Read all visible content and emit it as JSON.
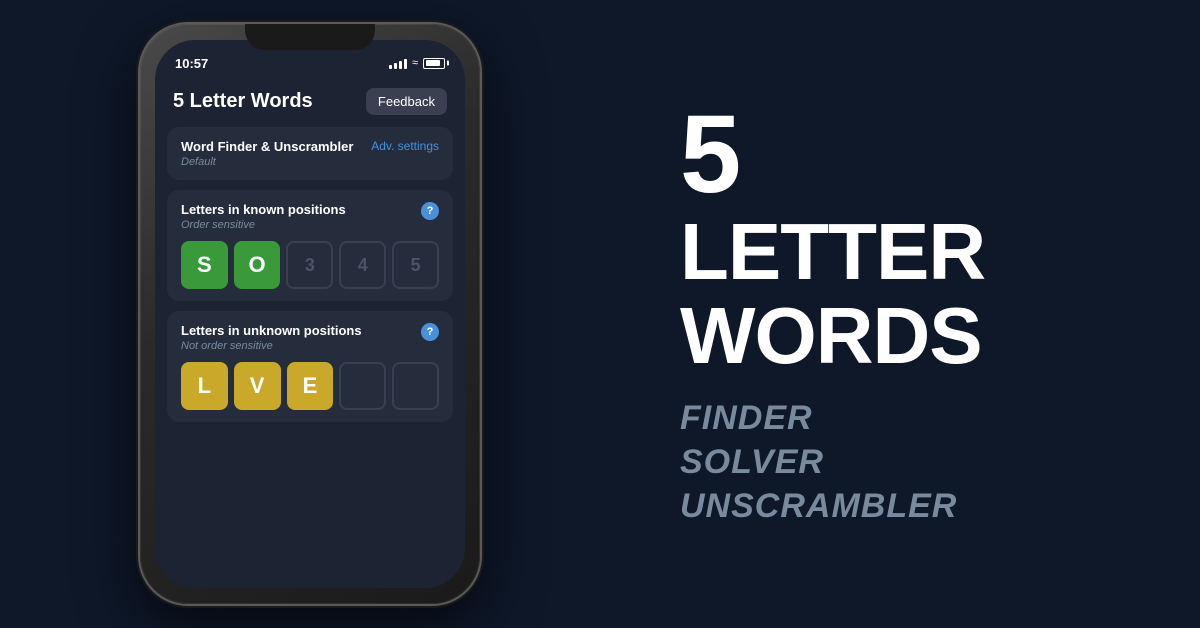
{
  "phone": {
    "status_bar": {
      "time": "10:57",
      "location_icon": "▶",
      "battery_label": "battery"
    },
    "header": {
      "title": "5 Letter Words",
      "feedback_button": "Feedback"
    },
    "word_finder_card": {
      "title": "Word Finder & Unscrambler",
      "subtitle": "Default",
      "adv_settings": "Adv. settings"
    },
    "known_positions_card": {
      "title": "Letters in known positions",
      "subtitle": "Order sensitive",
      "help": "?",
      "tiles": [
        {
          "letter": "S",
          "type": "green"
        },
        {
          "letter": "O",
          "type": "green"
        },
        {
          "letter": "3",
          "type": "empty"
        },
        {
          "letter": "4",
          "type": "empty"
        },
        {
          "letter": "5",
          "type": "empty"
        }
      ]
    },
    "unknown_positions_card": {
      "title": "Letters in unknown positions",
      "subtitle": "Not order sensitive",
      "help": "?",
      "tiles": [
        {
          "letter": "L",
          "type": "yellow"
        },
        {
          "letter": "V",
          "type": "yellow"
        },
        {
          "letter": "E",
          "type": "yellow"
        },
        {
          "letter": "",
          "type": "empty"
        },
        {
          "letter": "",
          "type": "empty"
        }
      ]
    }
  },
  "right_panel": {
    "headline_number": "5",
    "headline_line1": "LETTER",
    "headline_line2": "WORDS",
    "subtitle_lines": [
      "FINDER",
      "SOLVER",
      "UNSCRAMBLER"
    ]
  }
}
